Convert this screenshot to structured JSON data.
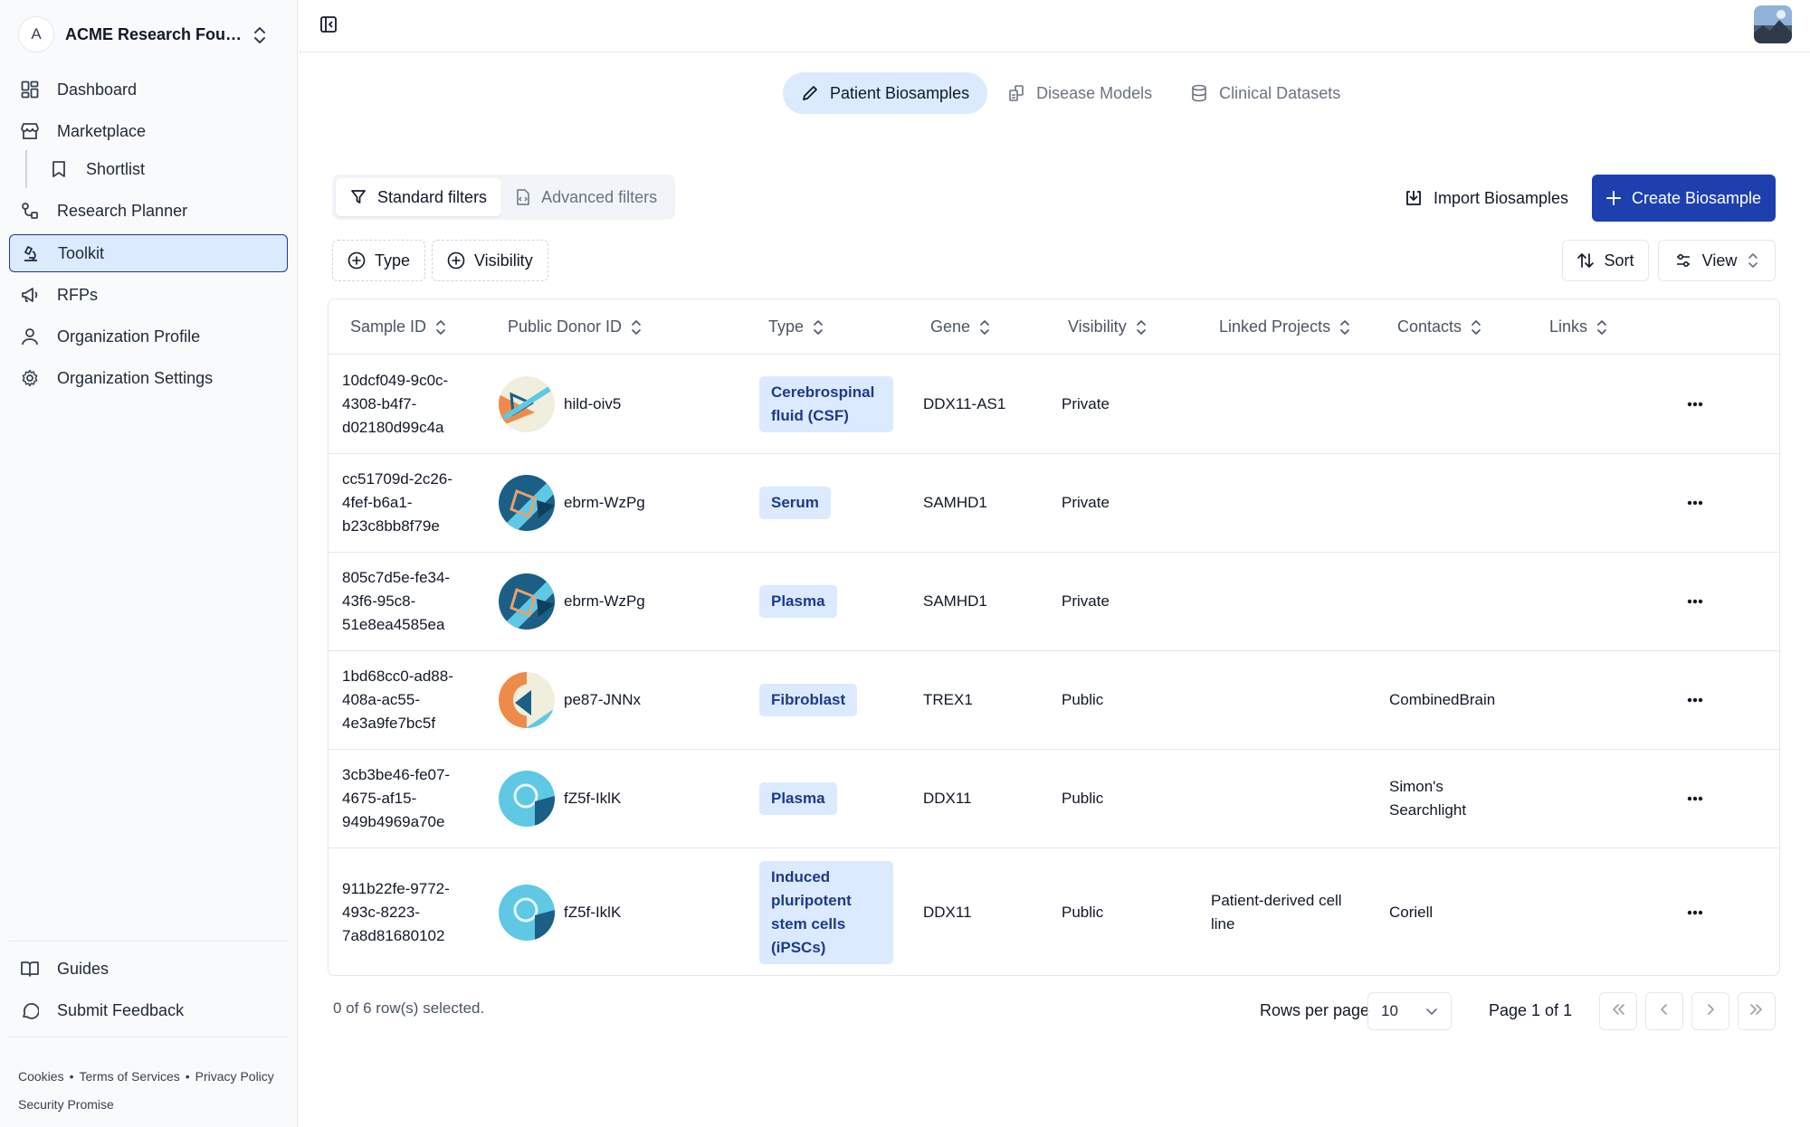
{
  "org": {
    "initial": "A",
    "name": "ACME Research Founda..."
  },
  "nav": {
    "dashboard": "Dashboard",
    "marketplace": "Marketplace",
    "shortlist": "Shortlist",
    "research_planner": "Research Planner",
    "toolkit": "Toolkit",
    "rfps": "RFPs",
    "org_profile": "Organization Profile",
    "org_settings": "Organization Settings",
    "guides": "Guides",
    "feedback": "Submit Feedback"
  },
  "footer": {
    "cookies": "Cookies",
    "terms": "Terms of Services",
    "privacy": "Privacy Policy",
    "security": "Security Promise",
    "separator": "•"
  },
  "tabs": {
    "patient_biosamples": "Patient Biosamples",
    "disease_models": "Disease Models",
    "clinical_datasets": "Clinical Datasets"
  },
  "filters": {
    "standard": "Standard filters",
    "advanced": "Advanced filters",
    "type_chip": "Type",
    "visibility_chip": "Visibility"
  },
  "actions": {
    "import": "Import Biosamples",
    "create": "Create Biosample",
    "sort": "Sort",
    "view": "View"
  },
  "table": {
    "headers": {
      "sample_id": "Sample ID",
      "donor_id": "Public Donor ID",
      "type": "Type",
      "gene": "Gene",
      "visibility": "Visibility",
      "linked_projects": "Linked Projects",
      "contacts": "Contacts",
      "links": "Links"
    },
    "rows": [
      {
        "sample_id": "10dcf049-9c0c-4308-b4f7-d02180d99c4a",
        "donor": "hild-oiv5",
        "type": "Cerebrospinal fluid (CSF)",
        "gene": "DDX11-AS1",
        "visibility": "Private",
        "linked": "",
        "contacts": ""
      },
      {
        "sample_id": "cc51709d-2c26-4fef-b6a1-b23c8bb8f79e",
        "donor": "ebrm-WzPg",
        "type": "Serum",
        "gene": "SAMHD1",
        "visibility": "Private",
        "linked": "",
        "contacts": ""
      },
      {
        "sample_id": "805c7d5e-fe34-43f6-95c8-51e8ea4585ea",
        "donor": "ebrm-WzPg",
        "type": "Plasma",
        "gene": "SAMHD1",
        "visibility": "Private",
        "linked": "",
        "contacts": ""
      },
      {
        "sample_id": "1bd68cc0-ad88-408a-ac55-4e3a9fe7bc5f",
        "donor": "pe87-JNNx",
        "type": "Fibroblast",
        "gene": "TREX1",
        "visibility": "Public",
        "linked": "",
        "contacts": "CombinedBrain"
      },
      {
        "sample_id": "3cb3be46-fe07-4675-af15-949b4969a70e",
        "donor": "fZ5f-IklK",
        "type": "Plasma",
        "gene": "DDX11",
        "visibility": "Public",
        "linked": "",
        "contacts": "Simon's Searchlight"
      },
      {
        "sample_id": "911b22fe-9772-493c-8223-7a8d81680102",
        "donor": "fZ5f-IklK",
        "type": "Induced pluripotent stem cells (iPSCs)",
        "gene": "DDX11",
        "visibility": "Public",
        "linked": "Patient-derived cell line",
        "contacts": "Coriell"
      }
    ]
  },
  "pagination": {
    "selected": "0 of 6 row(s) selected.",
    "rows_per_page_label": "Rows per page",
    "rows_per_page": "10",
    "page_info": "Page 1 of 1"
  },
  "colors": {
    "accent": "#1e40af",
    "badge_bg": "#dbeafe",
    "badge_text": "#1e3a8a"
  }
}
